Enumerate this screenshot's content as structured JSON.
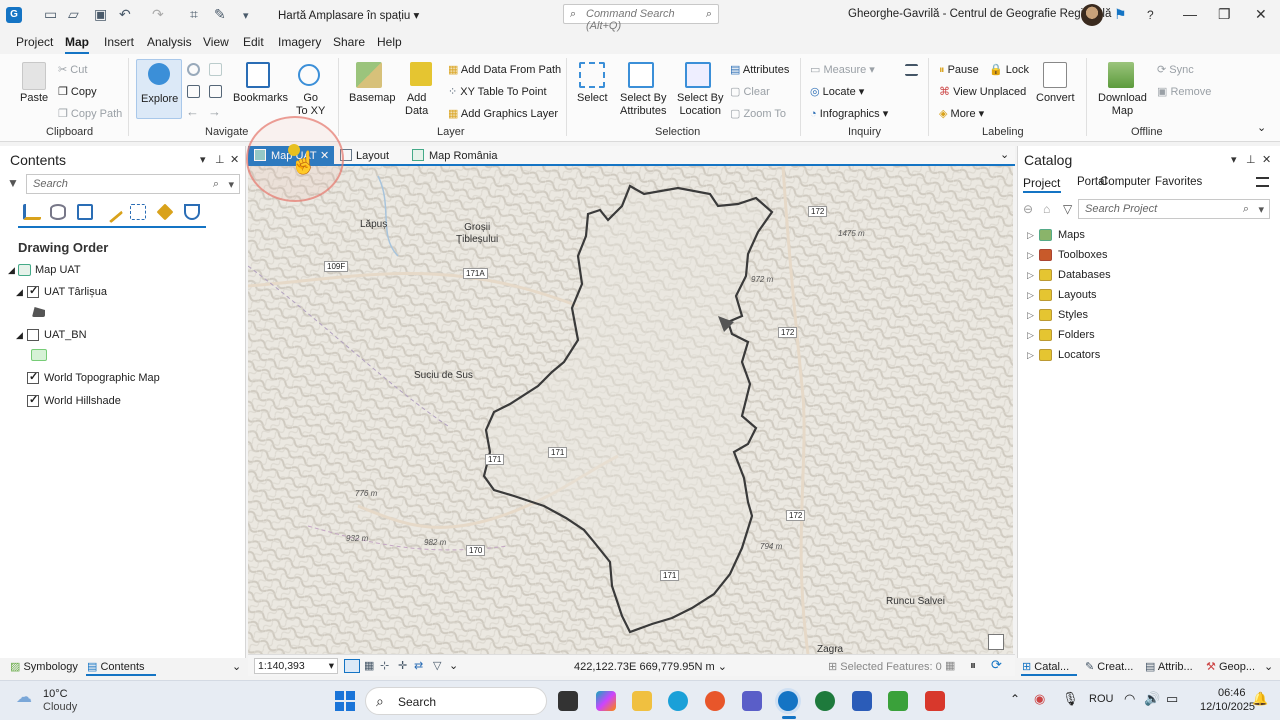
{
  "titlebar": {
    "app_glyph": "G",
    "doc_title": "Hartă Amplasare în spațiu",
    "command_search_placeholder": "Command Search (Alt+Q)",
    "user": "Gheorghe-Gavrilă - Centrul de Geografie Regională",
    "help": "?"
  },
  "ribbon_tabs": [
    "Project",
    "Map",
    "Insert",
    "Analysis",
    "View",
    "Edit",
    "Imagery",
    "Share",
    "Help"
  ],
  "ribbon": {
    "clipboard": {
      "paste": "Paste",
      "cut": "Cut",
      "copy": "Copy",
      "copy_path": "Copy Path",
      "group": "Clipboard"
    },
    "navigate": {
      "explore": "Explore",
      "bookmarks": "Bookmarks",
      "go_to_xy": "Go\nTo XY",
      "group": "Navigate"
    },
    "layer": {
      "basemap": "Basemap",
      "add_data": "Add\nData",
      "add_data_from_path": "Add Data From Path",
      "xy_table_to_point": "XY Table To Point",
      "add_graphics_layer": "Add Graphics Layer",
      "group": "Layer"
    },
    "selection": {
      "select": "Select",
      "select_by_attributes": "Select By\nAttributes",
      "select_by_location": "Select By\nLocation",
      "attributes": "Attributes",
      "clear": "Clear",
      "zoom_to": "Zoom To",
      "group": "Selection"
    },
    "inquiry": {
      "measure": "Measure",
      "locate": "Locate",
      "infographics": "Infographics",
      "group": "Inquiry"
    },
    "labeling": {
      "pause": "Pause",
      "lock": "Lock",
      "view_unplaced": "View Unplaced",
      "more": "More",
      "convert": "Convert",
      "group": "Labeling"
    },
    "offline": {
      "download_map": "Download\nMap",
      "sync": "Sync",
      "remove": "Remove",
      "group": "Offline"
    }
  },
  "contents": {
    "title": "Contents",
    "search_placeholder": "Search",
    "drawing_order": "Drawing Order",
    "layers": [
      {
        "name": "Map UAT",
        "checked": null
      },
      {
        "name": "UAT Târlișua",
        "checked": true
      },
      {
        "name": "UAT_BN",
        "checked": false
      },
      {
        "name": "World Topographic Map",
        "checked": true
      },
      {
        "name": "World Hillshade",
        "checked": true
      }
    ]
  },
  "map_tabs": [
    {
      "label": "Map UAT",
      "active": true
    },
    {
      "label": "Layout",
      "active": false
    },
    {
      "label": "Map România",
      "active": false
    }
  ],
  "map_labels": {
    "places": [
      "Lăpuș",
      "Groșii\nȚibleșului",
      "Suciu de Sus",
      "Runcu Salvei",
      "Zagra"
    ],
    "roads": [
      "109F",
      "171A",
      "172",
      "172",
      "171",
      "171",
      "170",
      "172",
      "171"
    ],
    "elevations": [
      "1475 m",
      "972 m",
      "776 m",
      "932 m",
      "982 m",
      "794 m"
    ]
  },
  "map_status": {
    "scale": "1:140,393",
    "coordinates": "422,122.73E 669,779.95N m",
    "selected_features": "Selected Features: 0"
  },
  "bottom_tabs": {
    "symbology": "Symbology",
    "contents": "Contents",
    "catalog": "Catal...",
    "create": "Creat...",
    "attributes": "Attrib...",
    "geo": "Geop..."
  },
  "catalog": {
    "title": "Catalog",
    "tabs": [
      "Project",
      "Portal",
      "Computer",
      "Favorites"
    ],
    "search_placeholder": "Search Project",
    "items": [
      "Maps",
      "Toolboxes",
      "Databases",
      "Layouts",
      "Styles",
      "Folders",
      "Locators"
    ]
  },
  "taskbar": {
    "weather_temp": "10°C",
    "weather_desc": "Cloudy",
    "search": "Search",
    "lang": "ROU",
    "time": "06:46",
    "date": "12/10/2025"
  }
}
